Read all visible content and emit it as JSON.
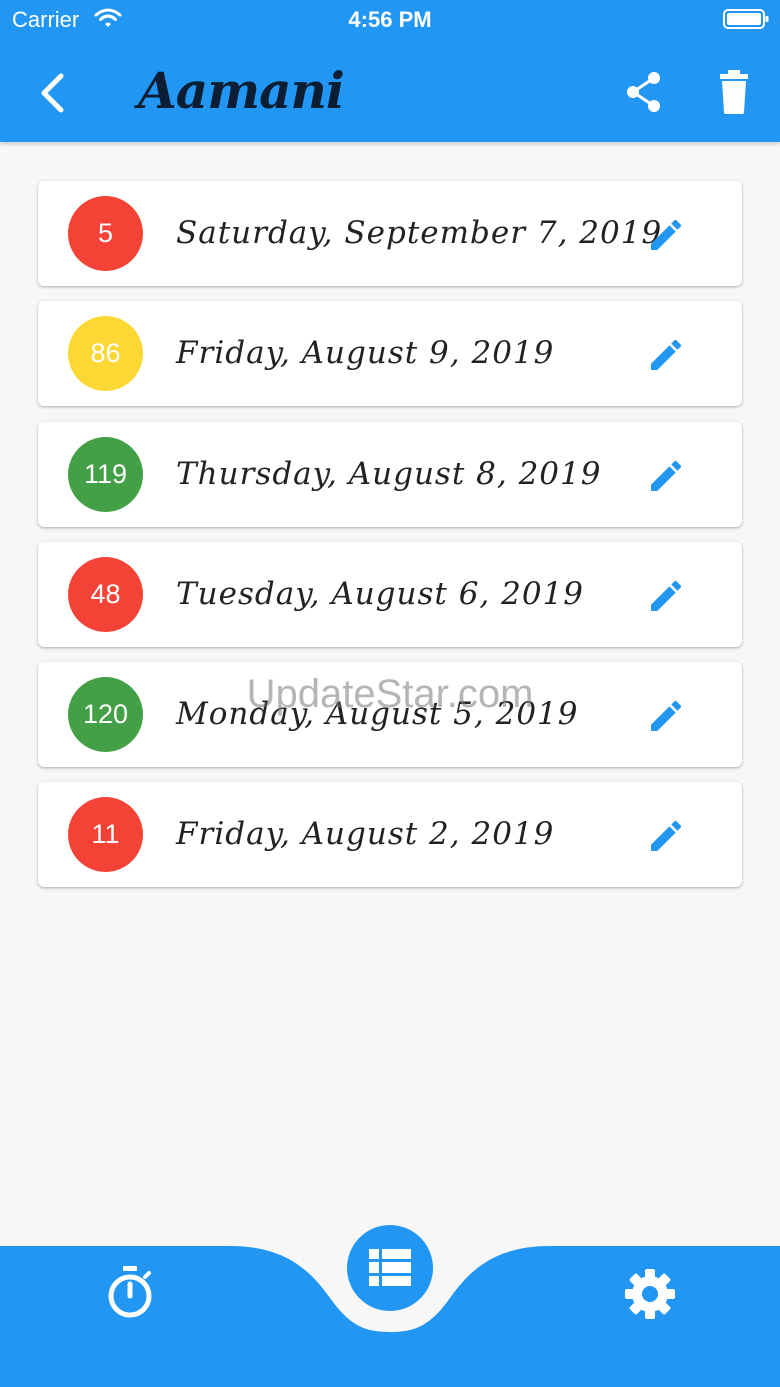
{
  "status_bar": {
    "carrier": "Carrier",
    "time": "4:56 PM"
  },
  "app_bar": {
    "title": "Aamani"
  },
  "entries": [
    {
      "score": "5",
      "date": "Saturday, September 7, 2019",
      "color": "#f44336"
    },
    {
      "score": "86",
      "date": "Friday, August 9, 2019",
      "color": "#fdd835"
    },
    {
      "score": "119",
      "date": "Thursday, August 8, 2019",
      "color": "#43a047"
    },
    {
      "score": "48",
      "date": "Tuesday, August 6, 2019",
      "color": "#f44336"
    },
    {
      "score": "120",
      "date": "Monday, August 5, 2019",
      "color": "#43a047"
    },
    {
      "score": "11",
      "date": "Friday, August 2, 2019",
      "color": "#f44336"
    }
  ],
  "watermark": "UpdateStar.com",
  "colors": {
    "primary": "#2196f3",
    "background": "#f7f7f7",
    "red": "#f44336",
    "yellow": "#fdd835",
    "green": "#43a047"
  },
  "icons": {
    "back": "chevron-left-icon",
    "share": "share-icon",
    "delete": "trash-icon",
    "edit": "pencil-icon",
    "timer": "stopwatch-icon",
    "list": "list-icon",
    "settings": "gear-icon"
  }
}
